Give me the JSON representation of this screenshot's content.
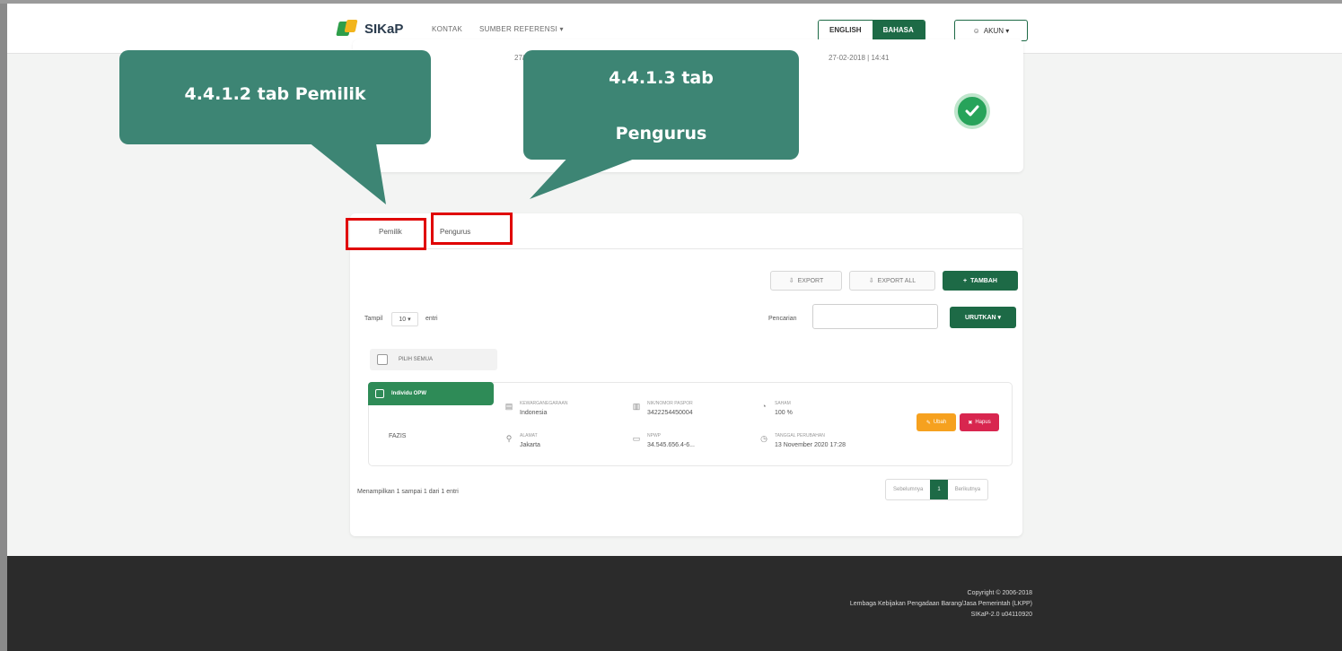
{
  "navbar": {
    "logo_text": "SIKaP",
    "links": [
      "KONTAK",
      "SUMBER REFERENSI ▾"
    ],
    "lang_en": "ENGLISH",
    "lang_id": "BAHASA",
    "account": "AKUN ▾"
  },
  "top_card": {
    "date_left": "27/",
    "date_right": "27-02-2018 | 14:41"
  },
  "callouts": {
    "pemilik": "4.4.1.2 tab Pemilik",
    "pengurus_line1": "4.4.1.3 tab",
    "pengurus_line2": "Pengurus"
  },
  "tabs": {
    "pemilik": "Pemilik",
    "pengurus": "Pengurus"
  },
  "toolbar": {
    "export": "EXPORT",
    "export_all": "EXPORT ALL",
    "tambah": "TAMBAH"
  },
  "table_controls": {
    "show_prefix": "Tampil",
    "show_value": "10 ▾",
    "show_suffix": "entri",
    "search_label": "Pencarian",
    "search_value": "",
    "urutkan": "URUTKAN ▾",
    "select_all": "PILIH SEMUA"
  },
  "row": {
    "badge": "Individu OPW",
    "name": "FAZIS",
    "fields": [
      {
        "label": "KEWARGANEGARAAN",
        "value": "Indonesia",
        "icon": "id-card-icon"
      },
      {
        "label": "NIK/NOMOR PASPOR",
        "value": "3422254450004",
        "icon": "barcode-icon"
      },
      {
        "label": "SAHAM",
        "value": "100 %",
        "icon": "pie-icon"
      },
      {
        "label": "ALAMAT",
        "value": "Jakarta",
        "icon": "location-icon"
      },
      {
        "label": "NPWP",
        "value": "34.545.656.4-6...",
        "icon": "card-icon"
      },
      {
        "label": "TANGGAL PERUBAHAN",
        "value": "13 November 2020 17:28",
        "icon": "clock-icon"
      }
    ],
    "edit": "Ubah",
    "delete": "Hapus"
  },
  "pagination": {
    "showing": "Menampilkan 1 sampai 1 dari 1 entri",
    "prev": "Sebelumnya",
    "current": "1",
    "next": "Berikutnya"
  },
  "footer": {
    "copyright": "Copyright © 2006-2018",
    "org": "Lembaga Kebijakan Pengadaan Barang/Jasa Pemerintah (LKPP)",
    "version": "SIKaP-2.0 u04110920"
  },
  "colors": {
    "brand_green": "#1d6a46",
    "callout": "#3d8574",
    "highlight": "#e00000",
    "edit": "#f6a11f",
    "delete": "#d8264f",
    "footer": "#2b2b2b"
  }
}
